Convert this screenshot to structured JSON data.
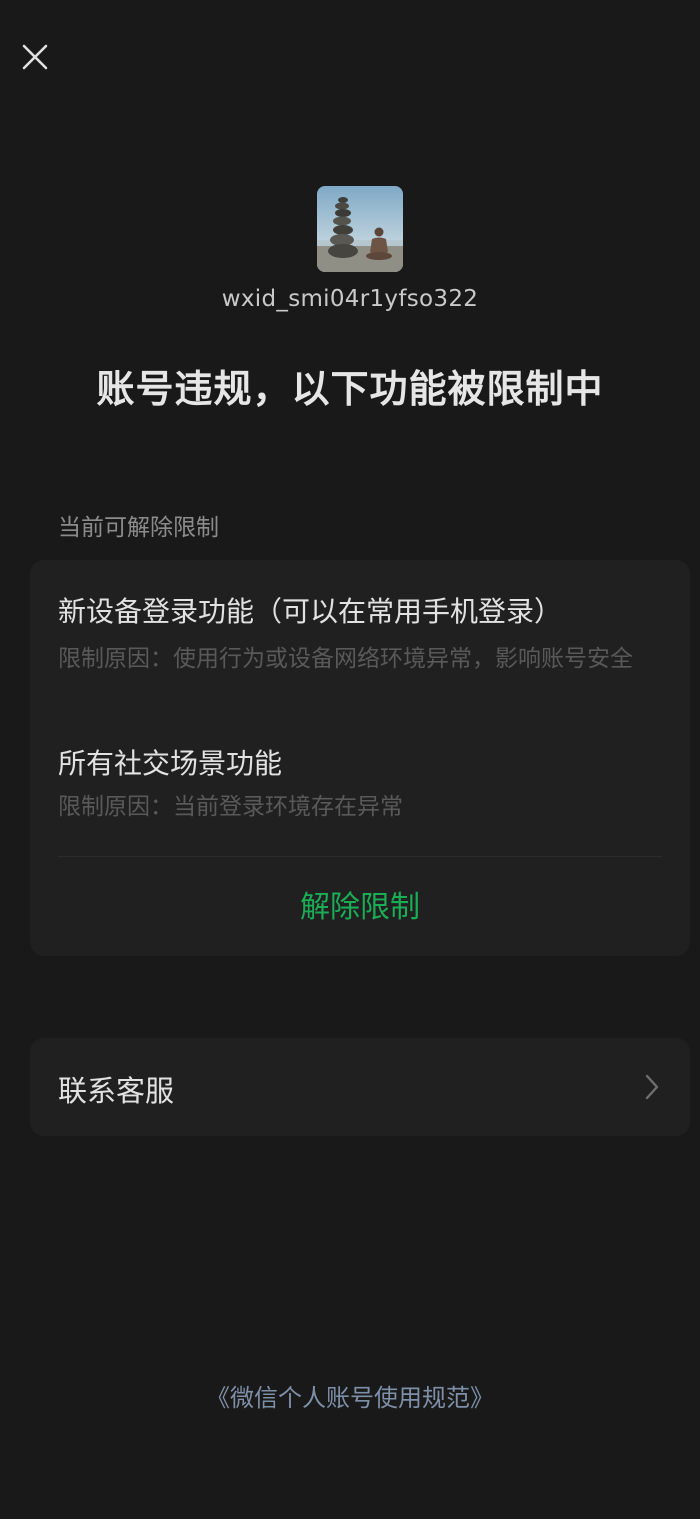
{
  "header": {
    "close_icon": "close-icon"
  },
  "profile": {
    "avatar_icon": "avatar-image",
    "account_id": "wxid_smi04r1yfso322"
  },
  "status": {
    "headline": "账号违规，以下功能被限制中"
  },
  "restrictions": {
    "section_label": "当前可解除限制",
    "items": [
      {
        "title": "新设备登录功能（可以在常用手机登录）",
        "reason": "限制原因：使用行为或设备网络环境异常，影响账号安全"
      },
      {
        "title": "所有社交场景功能",
        "reason": "限制原因：当前登录环境存在异常"
      }
    ],
    "lift_button_label": "解除限制",
    "lift_button_color": "#1aad55"
  },
  "support": {
    "contact_label": "联系客服",
    "chevron_icon": "chevron-right-icon"
  },
  "footer": {
    "policy_link": "《微信个人账号使用规范》",
    "link_color": "#7e8fa8"
  }
}
